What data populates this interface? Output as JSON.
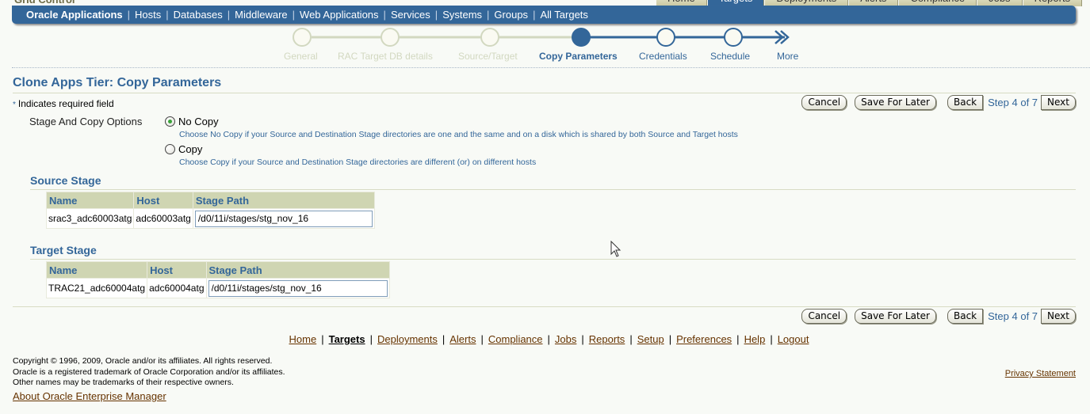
{
  "app": {
    "brand": "Grid Control"
  },
  "global_tabs": [
    {
      "label": "Home",
      "active": false
    },
    {
      "label": "Targets",
      "active": true
    },
    {
      "label": "Deployments",
      "active": false
    },
    {
      "label": "Alerts",
      "active": false
    },
    {
      "label": "Compliance",
      "active": false
    },
    {
      "label": "Jobs",
      "active": false
    },
    {
      "label": "Reports",
      "active": false
    }
  ],
  "navbar": {
    "items": [
      "Oracle Applications",
      "Hosts",
      "Databases",
      "Middleware",
      "Web Applications",
      "Services",
      "Systems",
      "Groups",
      "All Targets"
    ],
    "separator": "|"
  },
  "train": {
    "steps": [
      {
        "label": "General",
        "state": "visited"
      },
      {
        "label": "RAC Target DB details",
        "state": "visited"
      },
      {
        "label": "Source/Target",
        "state": "visited"
      },
      {
        "label": "Copy Parameters",
        "state": "current"
      },
      {
        "label": "Credentials",
        "state": "next"
      },
      {
        "label": "Schedule",
        "state": "next"
      },
      {
        "label": "More",
        "state": "more"
      }
    ],
    "colors": {
      "visited": "#d2d8c0",
      "active": "#336699"
    }
  },
  "page": {
    "title": "Clone Apps Tier: Copy Parameters",
    "required_star": "*",
    "required_note": "Indicates required field"
  },
  "buttons": {
    "cancel": "Cancel",
    "save_for_later": "Save For Later",
    "back": "Back",
    "step_text": "Step 4 of 7",
    "next": "Next"
  },
  "options": {
    "label": "Stage And Copy Options",
    "choices": [
      {
        "label": "No Copy",
        "checked": true,
        "hint": "Choose No Copy if your Source and Destination Stage directories are one and the same and on a disk which is shared by both Source and Target hosts"
      },
      {
        "label": "Copy",
        "checked": false,
        "hint": "Choose Copy if your Source and Destination Stage directories are different (or) on different hosts"
      }
    ]
  },
  "source_stage": {
    "title": "Source Stage",
    "columns": [
      "Name",
      "Host",
      "Stage Path"
    ],
    "rows": [
      {
        "name": "srac3_adc60003atg",
        "host": "adc60003atg",
        "stage_path": "/d0/11i/stages/stg_nov_16"
      }
    ]
  },
  "target_stage": {
    "title": "Target Stage",
    "columns": [
      "Name",
      "Host",
      "Stage Path"
    ],
    "rows": [
      {
        "name": "TRAC21_adc60004atg",
        "host": "adc60004atg",
        "stage_path": "/d0/11i/stages/stg_nov_16"
      }
    ]
  },
  "footer": {
    "links": [
      {
        "label": "Home",
        "current": false
      },
      {
        "label": "Targets",
        "current": true
      },
      {
        "label": "Deployments",
        "current": false
      },
      {
        "label": "Alerts",
        "current": false
      },
      {
        "label": "Compliance",
        "current": false
      },
      {
        "label": "Jobs",
        "current": false
      },
      {
        "label": "Reports",
        "current": false
      },
      {
        "label": "Setup",
        "current": false
      },
      {
        "label": "Preferences",
        "current": false
      },
      {
        "label": "Help",
        "current": false
      },
      {
        "label": "Logout",
        "current": false
      }
    ],
    "copyright_lines": [
      "Copyright © 1996, 2009, Oracle and/or its affiliates. All rights reserved.",
      "Oracle is a registered trademark of Oracle Corporation and/or its affiliates.",
      "Other names may be trademarks of their respective owners."
    ],
    "about": "About Oracle Enterprise Manager",
    "privacy": "Privacy Statement"
  }
}
